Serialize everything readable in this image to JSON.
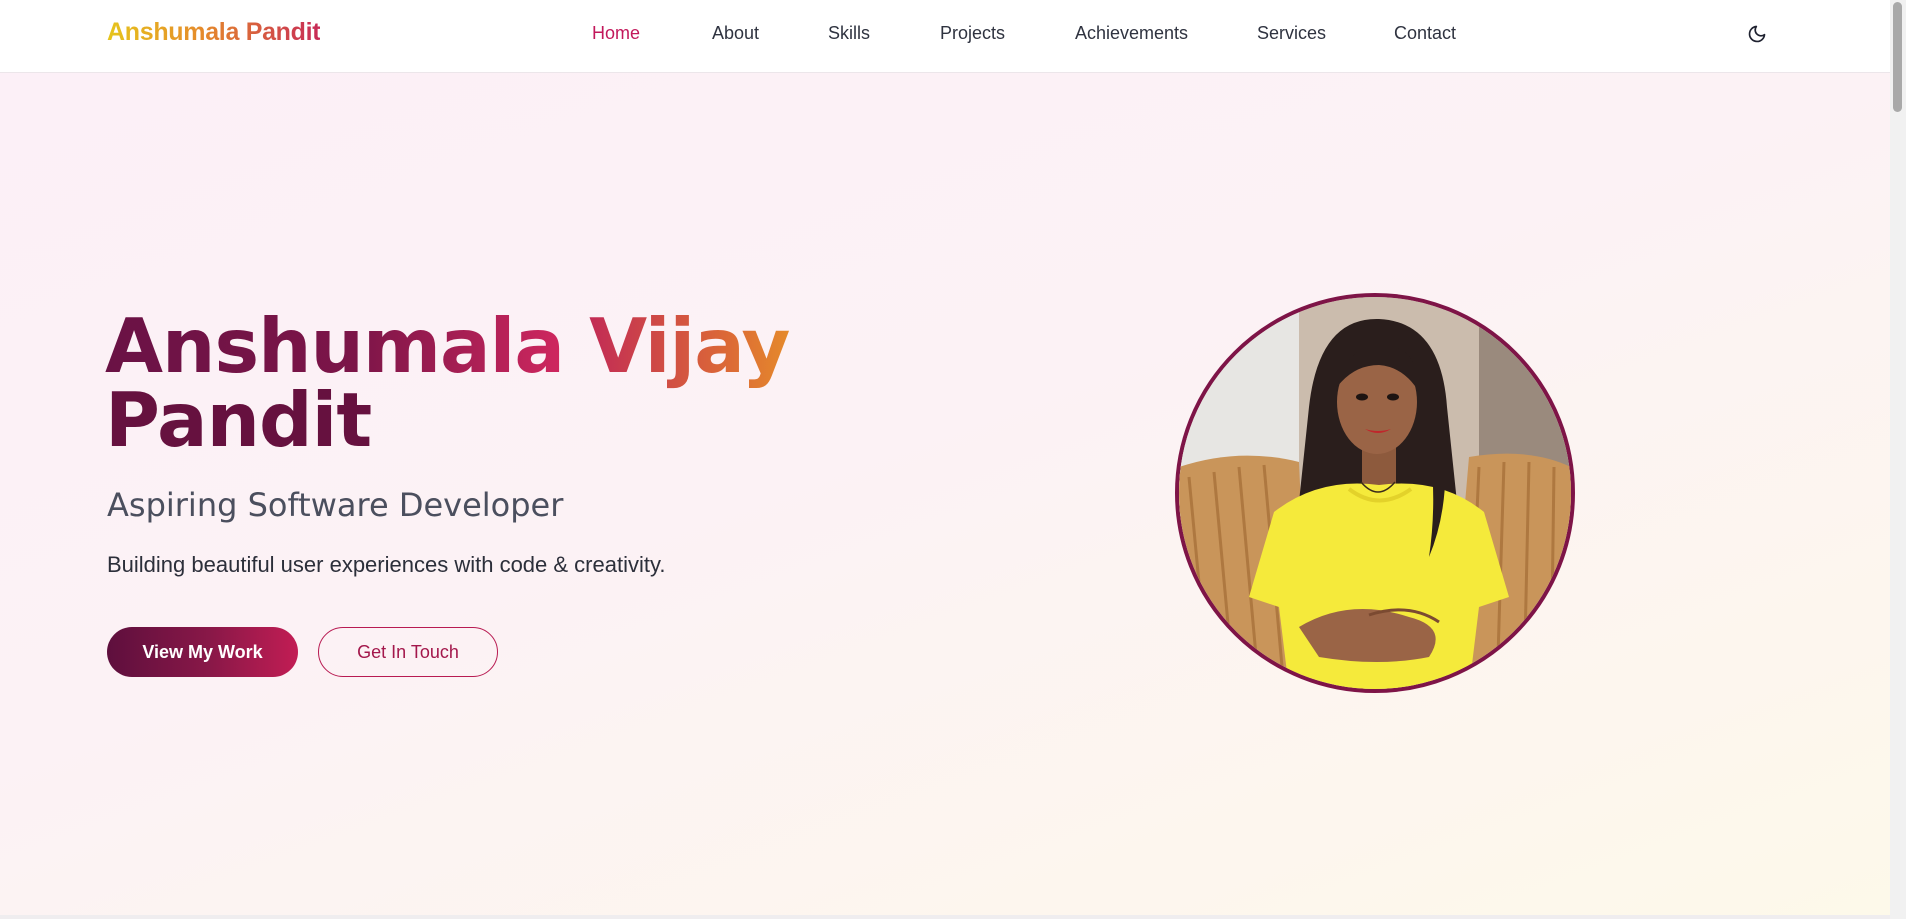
{
  "header": {
    "logo": "Anshumala Pandit",
    "nav": [
      {
        "label": "Home",
        "active": true
      },
      {
        "label": "About",
        "active": false
      },
      {
        "label": "Skills",
        "active": false
      },
      {
        "label": "Projects",
        "active": false
      },
      {
        "label": "Achievements",
        "active": false
      },
      {
        "label": "Services",
        "active": false
      },
      {
        "label": "Contact",
        "active": false
      }
    ],
    "theme_toggle_icon": "moon-icon"
  },
  "hero": {
    "name_part1": "Anshumala",
    "name_part2": "Vijay",
    "name_part3": "Pandit",
    "role": "Aspiring Software Developer",
    "tagline": "Building beautiful user experiences with code & creativity.",
    "primary_button": "View My Work",
    "secondary_button": "Get In Touch",
    "photo_icon": "profile-photo"
  },
  "colors": {
    "accent": "#c2185b",
    "primary_dark": "#6a1245",
    "orange": "#e58a2b",
    "gold": "#e6c51c"
  }
}
